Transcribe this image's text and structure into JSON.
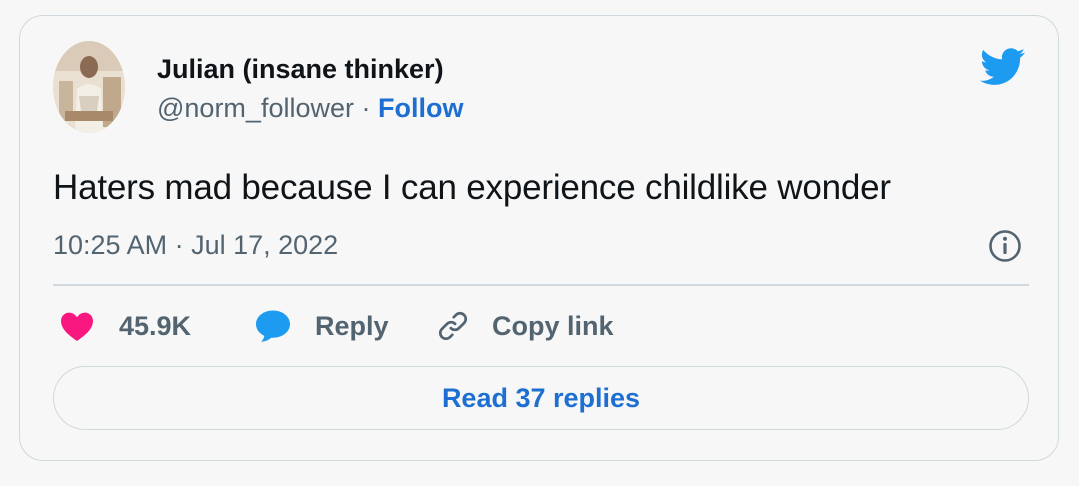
{
  "tweet": {
    "author": {
      "name": "Julian (insane thinker)",
      "handle": "@norm_follower",
      "separator": "·",
      "follow_label": "Follow"
    },
    "text": "Haters mad because I can experience childlike wonder",
    "timestamp": "10:25 AM · Jul 17, 2022"
  },
  "actions": {
    "like_count": "45.9K",
    "reply_label": "Reply",
    "copy_link_label": "Copy link"
  },
  "read_replies_label": "Read 37 replies",
  "icons": {
    "brand": "twitter-bird-icon",
    "info": "info-icon",
    "like": "heart-icon",
    "reply": "speech-bubble-icon",
    "copy": "link-icon"
  },
  "colors": {
    "accent": "#1d9bf0",
    "link": "#1d6fd1",
    "like": "#f91880",
    "text": "#0f1419",
    "secondary": "#536471",
    "border": "#cfd9de"
  }
}
